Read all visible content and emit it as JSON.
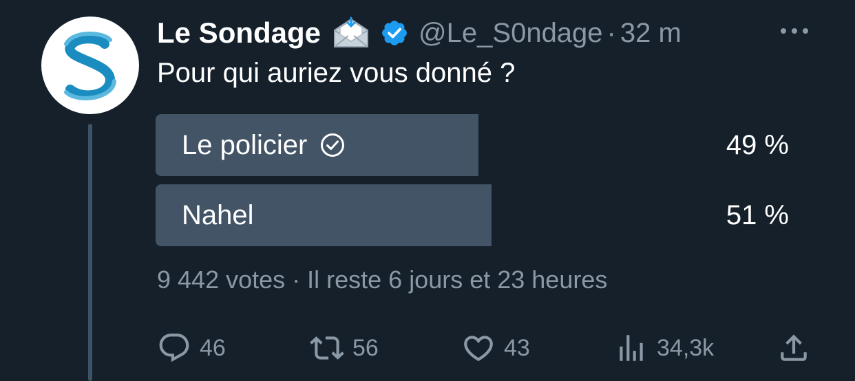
{
  "author": {
    "display_name": "Le Sondage",
    "handle": "@Le_S0ndage",
    "separator": "·",
    "timestamp": "32 m",
    "avatar_letter": "S",
    "brand_color": "#1a8cbf",
    "verified_color": "#1d9bf0"
  },
  "tweet": {
    "text": "Pour qui auriez vous donné ?"
  },
  "poll": {
    "options": [
      {
        "label": "Le policier",
        "percent_text": "49 %",
        "percent": 49,
        "selected": true
      },
      {
        "label": "Nahel",
        "percent_text": "51 %",
        "percent": 51,
        "selected": false
      }
    ],
    "meta": "9 442 votes · Il reste 6 jours et 23 heures"
  },
  "actions": {
    "replies": "46",
    "retweets": "56",
    "likes": "43",
    "views": "34,3k"
  },
  "icons": {
    "envelope": "incoming-envelope-icon",
    "verified": "verified-badge-icon",
    "more": "more-icon",
    "check": "check-circle-icon",
    "reply": "reply-icon",
    "retweet": "retweet-icon",
    "like": "heart-icon",
    "views": "views-icon",
    "share": "share-icon"
  },
  "colors": {
    "background": "#15202b",
    "poll_bar": "#435466",
    "secondary_text": "#8b98a5"
  }
}
